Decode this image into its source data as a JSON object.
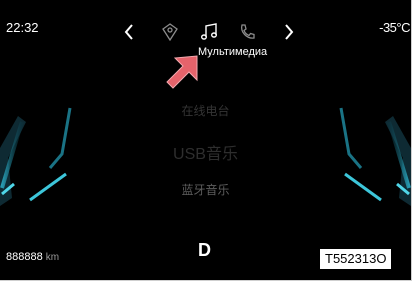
{
  "status": {
    "time": "22:32",
    "temperature": "-35°C"
  },
  "nav": {
    "prev_icon": "chevron-left-icon",
    "next_icon": "chevron-right-icon",
    "tabs": [
      {
        "icon": "navigation-pin-icon",
        "active": false
      },
      {
        "icon": "music-note-icon",
        "active": true
      },
      {
        "icon": "phone-icon",
        "active": false
      }
    ],
    "tooltip": "Мультимедиа"
  },
  "media_menu": {
    "items": [
      {
        "label": "在线电台"
      },
      {
        "label": "USB音乐"
      },
      {
        "label": "蓝牙音乐"
      }
    ]
  },
  "drive": {
    "gear": "D",
    "odometer_value": "888888",
    "odometer_unit": "km"
  },
  "reference_code": "T552313O",
  "annotation": {
    "icon": "pointer-arrow-icon",
    "color": "#e5636b"
  },
  "colors": {
    "accent_cyan": "#4fd6e8",
    "background": "#000000"
  }
}
